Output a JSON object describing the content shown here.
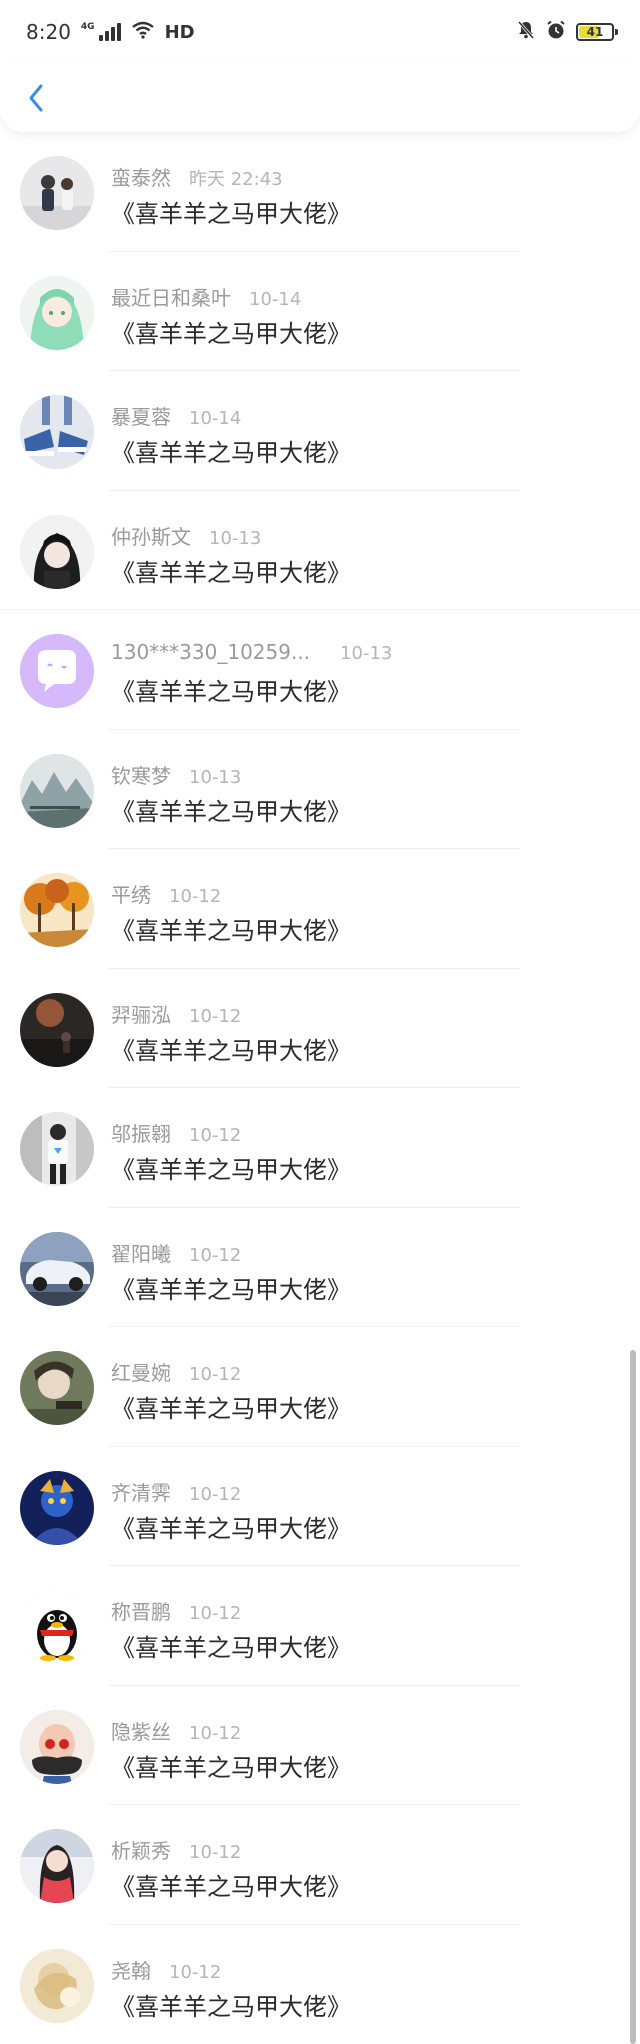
{
  "status_bar": {
    "time": "8:20",
    "network": "4G",
    "wifi_label": "HD",
    "battery": "41",
    "icons": [
      "signal-icon",
      "wifi-icon",
      "mute-bell-icon",
      "alarm-icon",
      "battery-icon"
    ]
  },
  "nav": {
    "back_icon": "chevron-left-icon",
    "accent": "#3a8ee6"
  },
  "items": [
    {
      "name": "蛮泰然",
      "time": "昨天 22:43",
      "title": "《喜羊羊之马甲大佬》"
    },
    {
      "name": "最近日和桑叶",
      "time": "10-14",
      "title": "《喜羊羊之马甲大佬》"
    },
    {
      "name": "暴夏蓉",
      "time": "10-14",
      "title": "《喜羊羊之马甲大佬》"
    },
    {
      "name": "仲孙斯文",
      "time": "10-13",
      "title": "《喜羊羊之马甲大佬》"
    },
    {
      "name": "130***330_10259...",
      "time": "10-13",
      "title": "《喜羊羊之马甲大佬》"
    },
    {
      "name": "钦寒梦",
      "time": "10-13",
      "title": "《喜羊羊之马甲大佬》"
    },
    {
      "name": "平绣",
      "time": "10-12",
      "title": "《喜羊羊之马甲大佬》"
    },
    {
      "name": "羿骊泓",
      "time": "10-12",
      "title": "《喜羊羊之马甲大佬》"
    },
    {
      "name": "邬振翱",
      "time": "10-12",
      "title": "《喜羊羊之马甲大佬》"
    },
    {
      "name": "翟阳曦",
      "time": "10-12",
      "title": "《喜羊羊之马甲大佬》"
    },
    {
      "name": "红曼婉",
      "time": "10-12",
      "title": "《喜羊羊之马甲大佬》"
    },
    {
      "name": "齐清霁",
      "time": "10-12",
      "title": "《喜羊羊之马甲大佬》"
    },
    {
      "name": "称晋鹏",
      "time": "10-12",
      "title": "《喜羊羊之马甲大佬》"
    },
    {
      "name": "隐紫丝",
      "time": "10-12",
      "title": "《喜羊羊之马甲大佬》"
    },
    {
      "name": "析颖秀",
      "time": "10-12",
      "title": "《喜羊羊之马甲大佬》"
    },
    {
      "name": "尧翰",
      "time": "10-12",
      "title": "《喜羊羊之马甲大佬》"
    }
  ]
}
